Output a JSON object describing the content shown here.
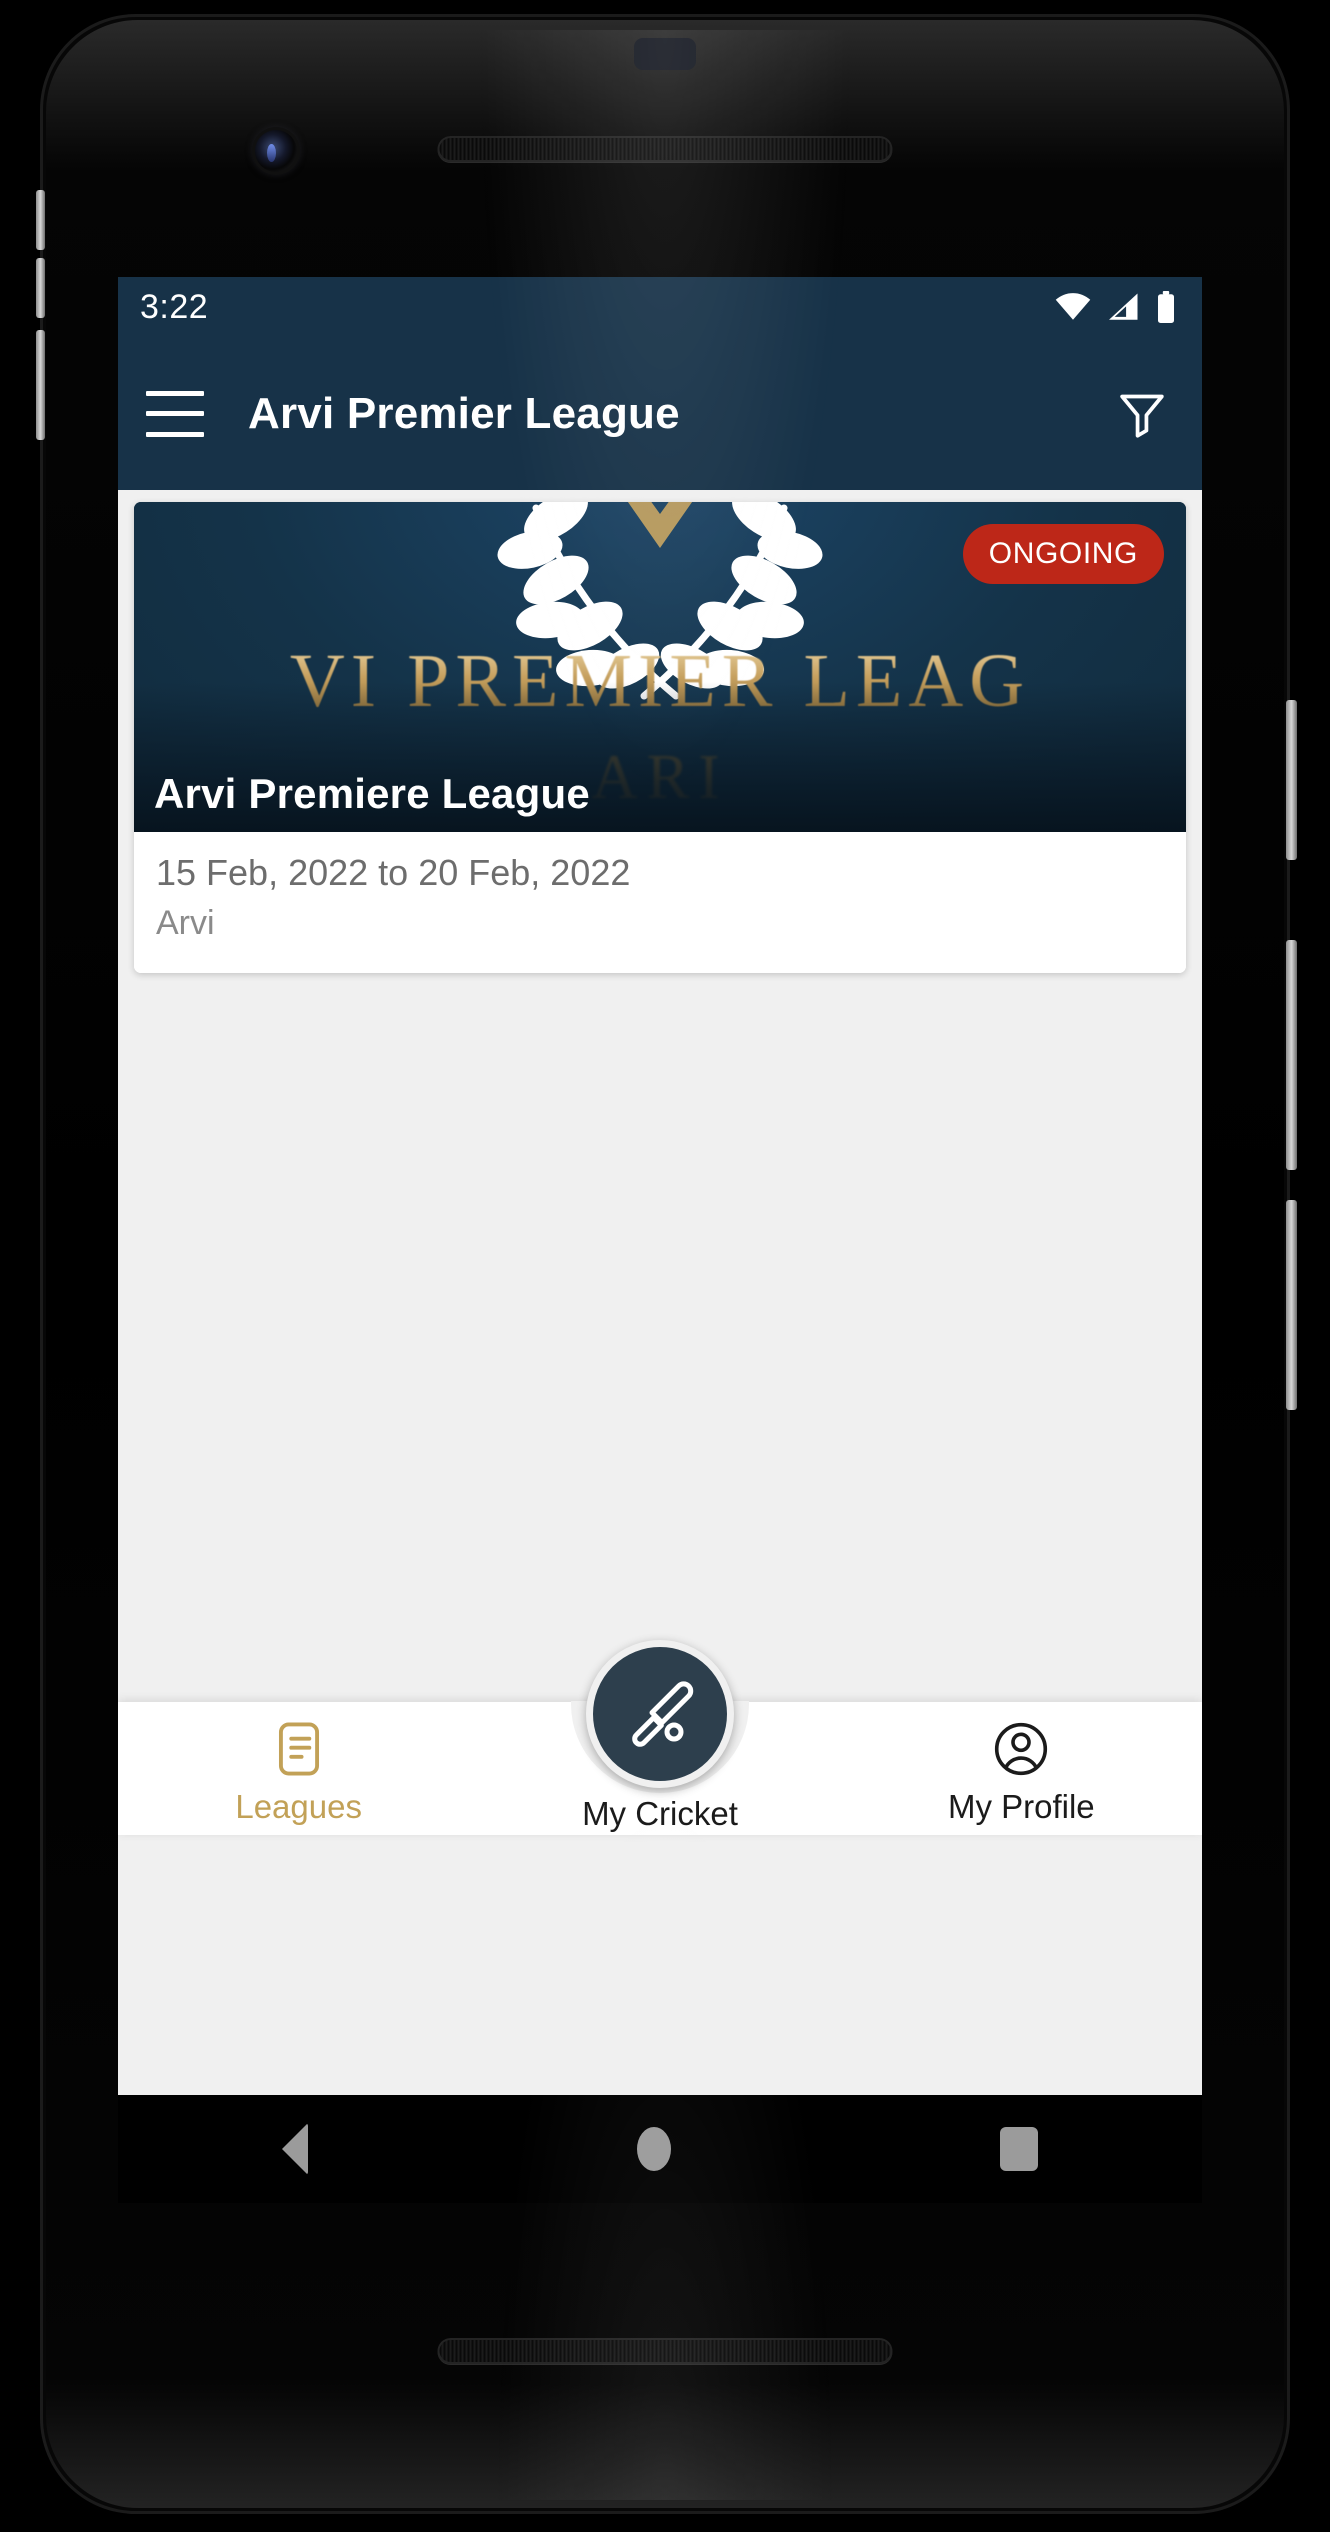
{
  "status_bar": {
    "time": "3:22",
    "icons": [
      "wifi-icon",
      "cellular-signal-icon",
      "battery-icon"
    ]
  },
  "app_bar": {
    "menu_icon": "hamburger-menu-icon",
    "title": "Arvi Premier League",
    "filter_icon": "filter-icon"
  },
  "league_card": {
    "banner": {
      "logo": "laurel-wreath-icon",
      "headline_text": "VI PREMIER LEAG",
      "subline_text": "ARI"
    },
    "status_badge": "ONGOING",
    "title": "Arvi Premiere League",
    "dates": "15 Feb, 2022  to 20 Feb, 2022",
    "venue": "Arvi"
  },
  "bottom_nav": {
    "items": [
      {
        "label": "Leagues",
        "icon": "league-list-icon",
        "active": true
      },
      {
        "label": "My Cricket",
        "icon": "cricket-bat-ball-icon",
        "active": false
      },
      {
        "label": "My Profile",
        "icon": "user-circle-icon",
        "active": false
      }
    ]
  },
  "android_nav": {
    "back": "back-triangle-icon",
    "home": "home-circle-icon",
    "recents": "recents-square-icon"
  },
  "colors": {
    "app_bar": "#173248",
    "accent_gold": "#c2a157",
    "badge_red": "#bd2718",
    "fab": "#2d3f4d",
    "page_bg": "#f0f0f0"
  }
}
